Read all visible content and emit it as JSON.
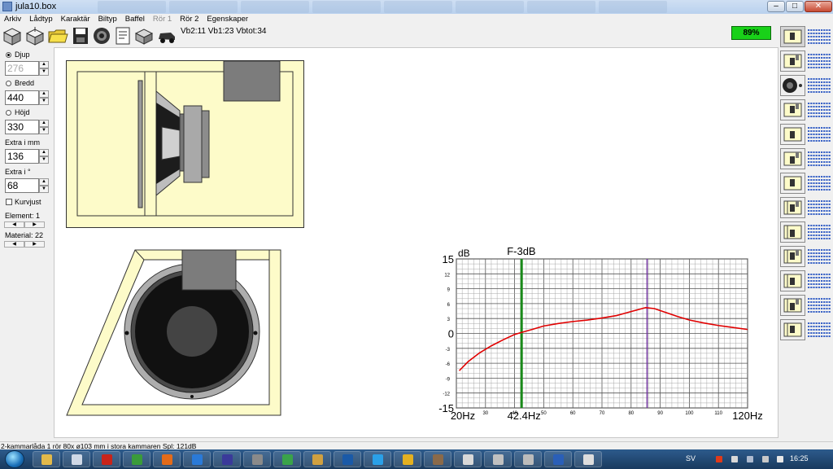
{
  "window": {
    "title": "jula10.box",
    "min_glyph": "–",
    "max_glyph": "□",
    "close_glyph": "✕"
  },
  "menu": [
    {
      "label": "Arkiv",
      "enabled": true
    },
    {
      "label": "Lådtyp",
      "enabled": true
    },
    {
      "label": "Karaktär",
      "enabled": true
    },
    {
      "label": "Biltyp",
      "enabled": true
    },
    {
      "label": "Baffel",
      "enabled": true
    },
    {
      "label": "Rör 1",
      "enabled": false
    },
    {
      "label": "Rör 2",
      "enabled": true
    },
    {
      "label": "Egenskaper",
      "enabled": true
    }
  ],
  "toolbar": {
    "icons": [
      "box-3d-icon",
      "box-open-icon",
      "folder-open-icon",
      "save-icon",
      "driver-icon",
      "document-icon",
      "box-closed-icon",
      "car-icon"
    ],
    "volume_status": "Vb2:11 Vb1:23 Vbtot:34",
    "progress_label": "89%",
    "progress_color": "#19d119"
  },
  "left_panel": {
    "djup": {
      "label": "Djup",
      "value": "276",
      "selected": true
    },
    "bredd": {
      "label": "Bredd",
      "value": "440",
      "selected": false
    },
    "hojd": {
      "label": "Höjd",
      "value": "330",
      "selected": false
    },
    "extra_mm": {
      "label": "Extra i mm",
      "value": "136"
    },
    "extra_deg": {
      "label": "Extra i °",
      "value": "68"
    },
    "kurvjust": {
      "label": "Kurvjust",
      "checked": false
    },
    "element": {
      "label": "Element: 1"
    },
    "material": {
      "label": "Material: 22"
    }
  },
  "chart_data": {
    "type": "line",
    "title": "F-3dB",
    "ylabel": "dB",
    "xlim": [
      20,
      120
    ],
    "ylim": [
      -15,
      15
    ],
    "x_tick_labels_large": [
      {
        "x": 20,
        "label": "20Hz"
      },
      {
        "x": 120,
        "label": "120Hz"
      }
    ],
    "x_tick_labels_small": [
      {
        "x": 30,
        "label": "30"
      },
      {
        "x": 40,
        "label": "40"
      },
      {
        "x": 50,
        "label": "50"
      },
      {
        "x": 60,
        "label": "60"
      },
      {
        "x": 70,
        "label": "70"
      },
      {
        "x": 80,
        "label": "80"
      },
      {
        "x": 90,
        "label": "90"
      },
      {
        "x": 100,
        "label": "100"
      },
      {
        "x": 110,
        "label": "110"
      }
    ],
    "y_tick_labels_large": [
      {
        "y": 15,
        "label": "15"
      },
      {
        "y": 0,
        "label": "0"
      },
      {
        "y": -15,
        "label": "-15"
      }
    ],
    "y_tick_labels_small": [
      {
        "y": 12,
        "label": "12"
      },
      {
        "y": 9,
        "label": "9"
      },
      {
        "y": 6,
        "label": "6"
      },
      {
        "y": 3,
        "label": "3"
      },
      {
        "y": -3,
        "label": "-3"
      },
      {
        "y": -6,
        "label": "-6"
      },
      {
        "y": -9,
        "label": "-9"
      },
      {
        "y": -12,
        "label": "-12"
      }
    ],
    "f3db_marker": {
      "x": 42.4,
      "label": "42.4Hz",
      "color": "#1a8a1a"
    },
    "tuning_marker": {
      "x": 85.5,
      "color": "#6a2a9a"
    },
    "series": [
      {
        "color": "#e00000",
        "x": [
          21,
          24,
          28,
          32,
          36,
          40,
          42.4,
          46,
          50,
          55,
          60,
          65,
          70,
          75,
          80,
          85,
          88,
          92,
          96,
          100,
          105,
          110,
          115,
          120
        ],
        "y": [
          -7.5,
          -5.7,
          -3.9,
          -2.5,
          -1.3,
          -0.2,
          0.2,
          0.8,
          1.5,
          2.0,
          2.4,
          2.7,
          3.1,
          3.6,
          4.4,
          5.2,
          5.0,
          4.2,
          3.4,
          2.7,
          2.1,
          1.6,
          1.2,
          0.8
        ]
      }
    ]
  },
  "right_sidebar": {
    "icons": [
      "box-type-sealed-icon",
      "box-type-ported-icon",
      "driver-round-icon",
      "box-type-bandpass-icon",
      "box-type-bandpass-dual-icon",
      "box-type-ported-slot-icon",
      "box-type-bandpass-slot-icon",
      "box-type-bandpass-multi-icon",
      "box-type-isobaric-icon",
      "box-type-ported-chamber-icon",
      "box-type-bandpass-6th-icon",
      "box-type-bandpass-tuned-icon",
      "box-type-isobaric-dual-icon"
    ]
  },
  "status_bar": {
    "text": "2-kammarlåda  1 rör 80x ø103 mm i stora kammaren Spl: 121dB"
  },
  "taskbar": {
    "language": "SV",
    "clock": "16:25",
    "apps": [
      "explorer-icon",
      "notepad-icon",
      "filezilla-icon",
      "chrome-icon",
      "firefox-icon",
      "ie-icon",
      "media-icon",
      "tool-icon",
      "green-app-icon",
      "app-icon",
      "photoshop-icon",
      "skype-icon",
      "messaging-icon",
      "gimp-icon",
      "window-icon",
      "window-icon",
      "speaker-icon",
      "word-icon",
      "window-icon"
    ]
  }
}
